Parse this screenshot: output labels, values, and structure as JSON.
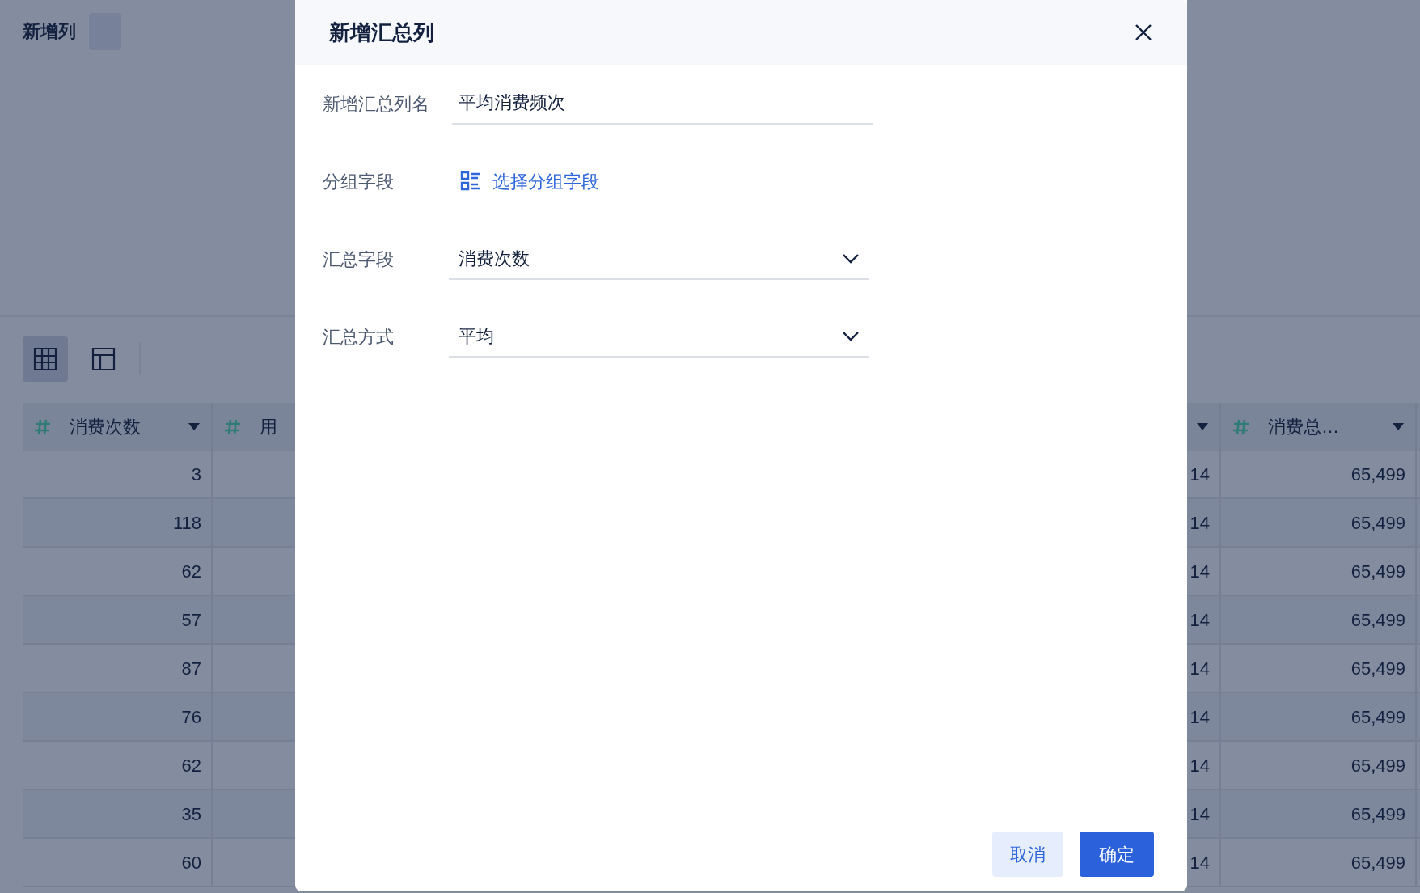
{
  "page": {
    "title": "新增列"
  },
  "view_toggle": [
    {
      "kind": "grid",
      "selected": true
    },
    {
      "kind": "layout",
      "selected": false
    }
  ],
  "table": {
    "columns": [
      {
        "kind": "number",
        "label": "消费次数"
      },
      {
        "kind": "number",
        "label": "用"
      },
      {
        "kind": "sort_only"
      },
      {
        "kind": "number",
        "label": "消费总…"
      }
    ],
    "rows": [
      {
        "col_1": "3",
        "col_3": "14",
        "col_4": "65,499"
      },
      {
        "col_1": "118",
        "col_3": "14",
        "col_4": "65,499"
      },
      {
        "col_1": "62",
        "col_3": "14",
        "col_4": "65,499"
      },
      {
        "col_1": "57",
        "col_3": "14",
        "col_4": "65,499"
      },
      {
        "col_1": "87",
        "col_3": "14",
        "col_4": "65,499"
      },
      {
        "col_1": "76",
        "col_3": "14",
        "col_4": "65,499"
      },
      {
        "col_1": "62",
        "col_3": "14",
        "col_4": "65,499"
      },
      {
        "col_1": "35",
        "col_3": "14",
        "col_4": "65,499"
      },
      {
        "col_1": "60",
        "col_3": "14",
        "col_4": "65,499"
      }
    ]
  },
  "dialog": {
    "title": "新增汇总列",
    "fields": [
      {
        "kind": "input",
        "label": "新增汇总列名",
        "value": "平均消费频次"
      },
      {
        "kind": "link",
        "label": "分组字段",
        "value": "选择分组字段"
      },
      {
        "kind": "select",
        "label": "汇总字段",
        "value": "消费次数"
      },
      {
        "kind": "select",
        "label": "汇总方式",
        "value": "平均"
      }
    ],
    "buttons": [
      {
        "kind": "secondary",
        "label": "取消"
      },
      {
        "kind": "primary",
        "label": "确定"
      }
    ]
  }
}
